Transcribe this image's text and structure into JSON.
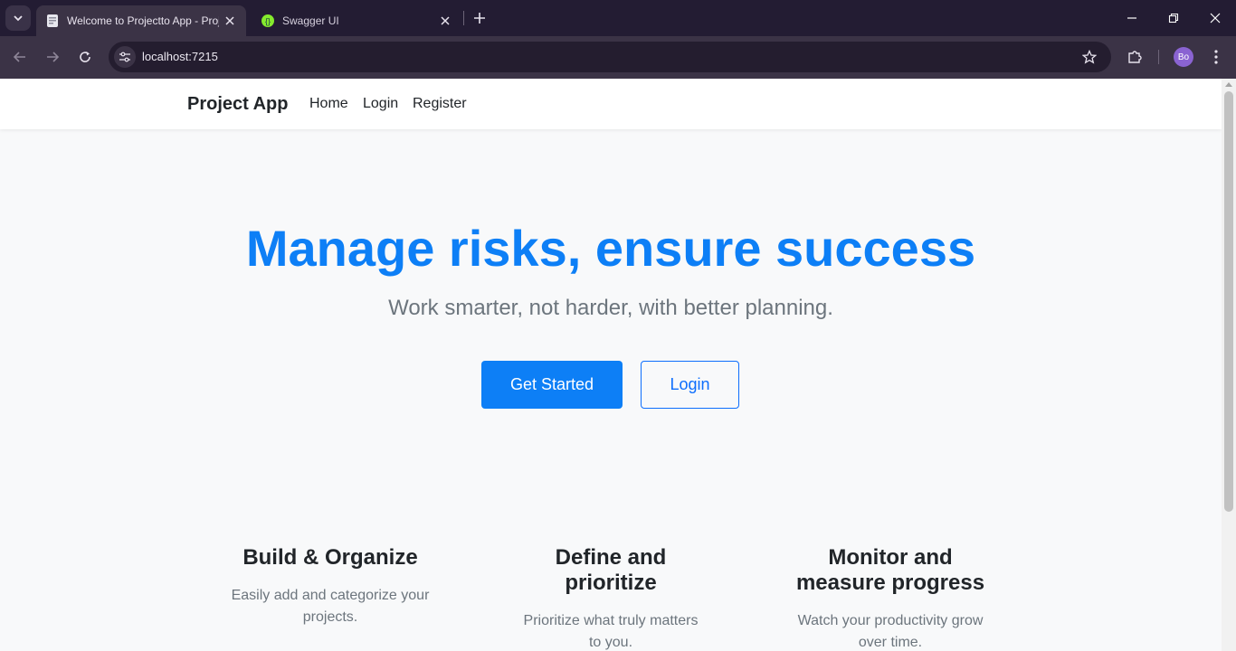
{
  "browser": {
    "tabs": [
      {
        "title": "Welcome to Projectto App - Projectto",
        "active": true
      },
      {
        "title": "Swagger UI",
        "active": false
      }
    ],
    "url": "localhost:7215",
    "profile_initials": "Bo"
  },
  "site": {
    "brand": "Project App",
    "nav": [
      "Home",
      "Login",
      "Register"
    ]
  },
  "hero": {
    "title": "Manage risks, ensure success",
    "subtitle": "Work smarter, not harder, with better planning.",
    "primary_button": "Get Started",
    "secondary_button": "Login"
  },
  "features": [
    {
      "title": "Build & Organize",
      "text": "Easily add and categorize your projects."
    },
    {
      "title": "Define and prioritize",
      "text": "Prioritize what truly matters to you."
    },
    {
      "title": "Monitor and measure progress",
      "text": "Watch your productivity grow over time."
    }
  ],
  "colors": {
    "accent": "#0d7ff6",
    "muted_text": "#6c757d",
    "chrome_dark": "#231c33"
  }
}
